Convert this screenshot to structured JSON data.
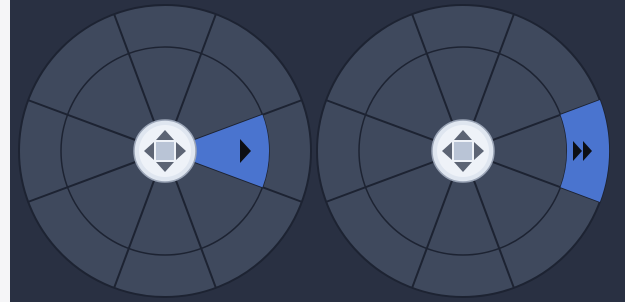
{
  "colors": {
    "panel_bg": "#293042",
    "wheel_fill": "#3f495d",
    "wheel_line": "#1d2332",
    "highlight": "#4a74cf",
    "center_btn": "#dfe6f0",
    "arrow": "#5c6474"
  },
  "wheels": [
    {
      "name": "navigation-wheel-left",
      "highlighted_sector": "right",
      "highlighted_ring": "inner",
      "arrow_icon": "play-icon"
    },
    {
      "name": "navigation-wheel-right",
      "highlighted_sector": "right",
      "highlighted_ring": "outer",
      "arrow_icon": "fast-forward-icon"
    }
  ]
}
